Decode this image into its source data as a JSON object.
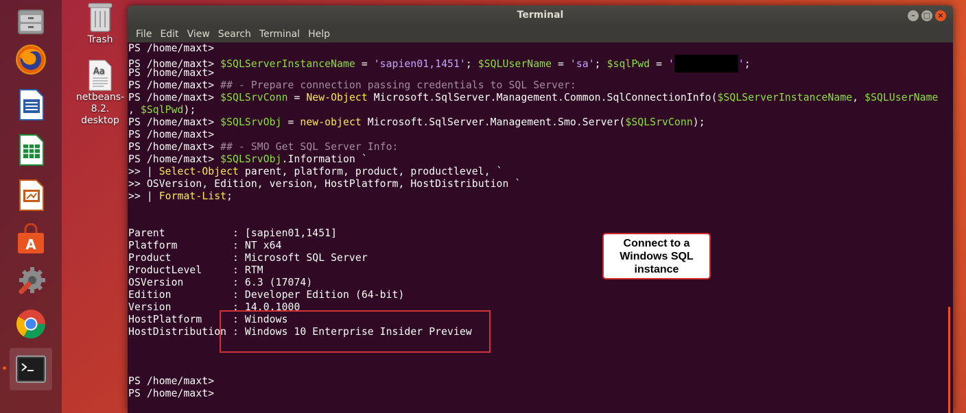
{
  "desktop": {
    "icons": [
      {
        "label": "Trash",
        "icon": "trash-icon"
      },
      {
        "label": "netbeans-\n8.2.\ndesktop",
        "icon": "text-file-icon"
      }
    ]
  },
  "launcher": {
    "items": [
      "files-icon",
      "firefox-icon",
      "writer-icon",
      "calc-icon",
      "impress-icon",
      "software-center-icon",
      "system-settings-icon",
      "chrome-icon",
      "terminal-icon"
    ],
    "accent": "#e95420"
  },
  "window": {
    "title": "Terminal",
    "menu": [
      "File",
      "Edit",
      "View",
      "Search",
      "Terminal",
      "Help"
    ]
  },
  "terminal": {
    "lines": [
      [
        {
          "t": "PS /home/maxt> ",
          "c": ""
        }
      ],
      [
        {
          "t": "PS /home/maxt> ",
          "c": ""
        },
        {
          "t": "$SQLServerInstanceName",
          "c": "var"
        },
        {
          "t": " = ",
          "c": ""
        },
        {
          "t": "'sapien01,1451'",
          "c": "str"
        },
        {
          "t": "; ",
          "c": ""
        },
        {
          "t": "$SQLUserName",
          "c": "var"
        },
        {
          "t": " = ",
          "c": ""
        },
        {
          "t": "'sa'",
          "c": "str"
        },
        {
          "t": "; ",
          "c": ""
        },
        {
          "t": "$sqlPwd",
          "c": "var"
        },
        {
          "t": " = ",
          "c": ""
        },
        {
          "t": "'",
          "c": "str"
        },
        {
          "t": "",
          "c": "redact"
        },
        {
          "t": "'",
          "c": "str"
        },
        {
          "t": ";",
          "c": ""
        }
      ],
      [
        {
          "t": "PS /home/maxt> ",
          "c": ""
        }
      ],
      [
        {
          "t": "PS /home/maxt> ",
          "c": ""
        },
        {
          "t": "## - Prepare connection passing credentials to SQL Server:",
          "c": "cmt"
        }
      ],
      [
        {
          "t": "PS /home/maxt> ",
          "c": ""
        },
        {
          "t": "$SQLSrvConn",
          "c": "var"
        },
        {
          "t": " = ",
          "c": ""
        },
        {
          "t": "New-Object",
          "c": "cmd"
        },
        {
          "t": " Microsoft.SqlServer.Management.Common.SqlConnectionInfo(",
          "c": ""
        },
        {
          "t": "$SQLServerInstanceName",
          "c": "var"
        },
        {
          "t": ", ",
          "c": ""
        },
        {
          "t": "$SQLUserName",
          "c": "var"
        }
      ],
      [
        {
          "t": ", ",
          "c": ""
        },
        {
          "t": "$SqlPwd",
          "c": "var"
        },
        {
          "t": ");",
          "c": ""
        }
      ],
      [
        {
          "t": "PS /home/maxt> ",
          "c": ""
        },
        {
          "t": "$SQLSrvObj",
          "c": "var"
        },
        {
          "t": " = ",
          "c": ""
        },
        {
          "t": "new-object",
          "c": "cmd"
        },
        {
          "t": " Microsoft.SqlServer.Management.Smo.Server(",
          "c": ""
        },
        {
          "t": "$SQLSrvConn",
          "c": "var"
        },
        {
          "t": ");",
          "c": ""
        }
      ],
      [
        {
          "t": "PS /home/maxt> ",
          "c": ""
        }
      ],
      [
        {
          "t": "PS /home/maxt> ",
          "c": ""
        },
        {
          "t": "## - SMO Get SQL Server Info:",
          "c": "cmt"
        }
      ],
      [
        {
          "t": "PS /home/maxt> ",
          "c": ""
        },
        {
          "t": "$SQLSrvObj",
          "c": "var"
        },
        {
          "t": ".Information `",
          "c": ""
        }
      ],
      [
        {
          "t": ">> | ",
          "c": ""
        },
        {
          "t": "Select-Object",
          "c": "cmd"
        },
        {
          "t": " parent, platform, product, productlevel, `",
          "c": ""
        }
      ],
      [
        {
          "t": ">> OSVersion, Edition, version, HostPlatform, HostDistribution `",
          "c": ""
        }
      ],
      [
        {
          "t": ">> | ",
          "c": ""
        },
        {
          "t": "Format-List",
          "c": "cmd"
        },
        {
          "t": ";",
          "c": ""
        }
      ],
      [],
      [],
      [
        {
          "t": "Parent           : [sapien01,1451]",
          "c": ""
        }
      ],
      [
        {
          "t": "Platform         : NT x64",
          "c": ""
        }
      ],
      [
        {
          "t": "Product          : Microsoft SQL Server",
          "c": ""
        }
      ],
      [
        {
          "t": "ProductLevel     : RTM",
          "c": ""
        }
      ],
      [
        {
          "t": "OSVersion        : 6.3 (17074)",
          "c": ""
        }
      ],
      [
        {
          "t": "Edition          : Developer Edition (64-bit)",
          "c": ""
        }
      ],
      [
        {
          "t": "Version          : 14.0.1000",
          "c": ""
        }
      ],
      [
        {
          "t": "HostPlatform     : Windows",
          "c": ""
        }
      ],
      [
        {
          "t": "HostDistribution : Windows 10 Enterprise Insider Preview",
          "c": ""
        }
      ],
      [],
      [],
      [],
      [
        {
          "t": "PS /home/maxt> ",
          "c": ""
        }
      ],
      [
        {
          "t": "PS /home/maxt> ",
          "c": ""
        }
      ]
    ]
  },
  "annotation": {
    "text": "Connect to a\nWindows SQL\ninstance"
  }
}
